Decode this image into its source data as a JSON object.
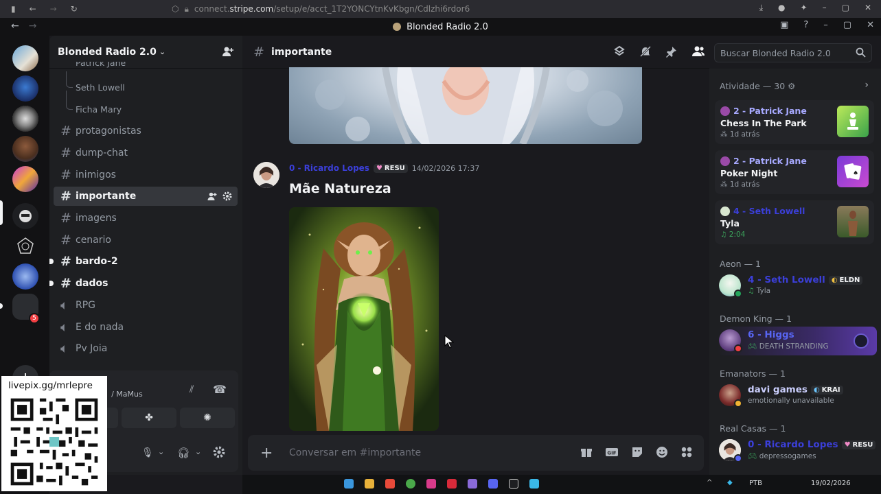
{
  "browser": {
    "url_prefix": "connect.",
    "url_domain": "stripe.com",
    "url_rest": "/setup/e/acct_1T2YONCYtnKvKbgn/Cdlzhi6rdor6"
  },
  "window": {
    "title": "Blonded Radio 2.0"
  },
  "server": {
    "name": "Blonded Radio 2.0",
    "notification_count": "5"
  },
  "sidebar": {
    "threads": [
      {
        "label": "Patrick Jane"
      },
      {
        "label": "Seth Lowell"
      },
      {
        "label": "Ficha Mary"
      }
    ],
    "channels": [
      {
        "label": "protagonistas",
        "type": "text"
      },
      {
        "label": "dump-chat",
        "type": "text"
      },
      {
        "label": "inimigos",
        "type": "text"
      },
      {
        "label": "importante",
        "type": "text",
        "active": true
      },
      {
        "label": "imagens",
        "type": "text"
      },
      {
        "label": "cenario",
        "type": "text"
      },
      {
        "label": "bardo-2",
        "type": "text",
        "unread": true
      },
      {
        "label": "dados",
        "type": "text",
        "unread": true
      },
      {
        "label": "RPG",
        "type": "voice"
      },
      {
        "label": "E do nada",
        "type": "voice"
      },
      {
        "label": "Pv Joia",
        "type": "voice"
      }
    ]
  },
  "voice_panel": {
    "channel": "/ MaMus"
  },
  "overlay": {
    "qr_label": "livepix.gg/mrlepre"
  },
  "chat": {
    "channel_name": "importante",
    "message": {
      "author": "0 - Ricardo Lopes",
      "tag": "RESU",
      "timestamp": "14/02/2026 17:37",
      "title": "Mãe Natureza"
    },
    "composer_placeholder": "Conversar em #importante",
    "search_placeholder": "Buscar Blonded Radio 2.0"
  },
  "members": {
    "activity_header": "Atividade — 30",
    "activity_cards": [
      {
        "who": "2 - Patrick Jane",
        "what": "Chess In The Park",
        "when": "1d atrás"
      },
      {
        "who": "2 - Patrick Jane",
        "what": "Poker Night",
        "when": "1d atrás"
      },
      {
        "who": "4 - Seth Lowell",
        "what": "Tyla",
        "when": "2:04"
      }
    ],
    "groups": [
      {
        "title": "Aeon — 1",
        "member": {
          "name": "4 - Seth Lowell",
          "tag": "ELDN",
          "status": "Tyla",
          "color": "#3b3fd9"
        }
      },
      {
        "title": "Demon King — 1",
        "member": {
          "name": "6 - Higgs",
          "status": "DEATH STRANDING",
          "color": "#5865f2"
        }
      },
      {
        "title": "Emanators — 1",
        "member": {
          "name": "davi games",
          "tag": "KRAI",
          "status": "emotionally unavailable",
          "color": "#c9cdfb"
        }
      },
      {
        "title": "Real Casas — 1",
        "member": {
          "name": "0 - Ricardo Lopes",
          "tag": "RESU",
          "status": "depressogames",
          "color": "#3b3fd9"
        }
      }
    ]
  },
  "taskbar": {
    "lang": "PTB",
    "date": "19/02/2026"
  },
  "colors": {
    "accent": "#5865f2",
    "online": "#23a55a",
    "dnd": "#f23f43"
  }
}
